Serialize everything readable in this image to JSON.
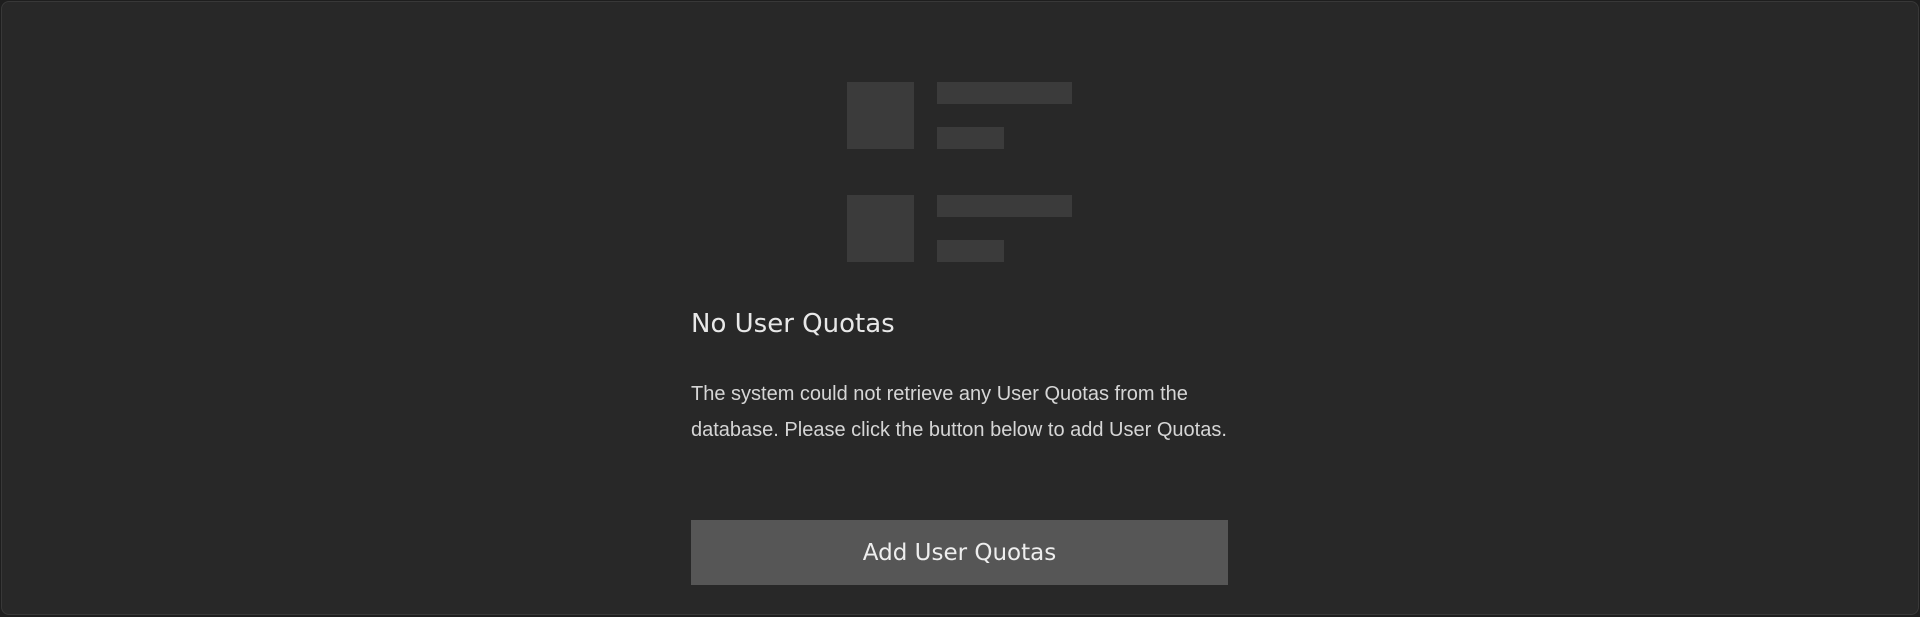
{
  "empty_state": {
    "illustration_icon": "list-placeholder-icon",
    "title": "No User Quotas",
    "description": "The system could not retrieve any User Quotas from the database. Please click the button below to add User Quotas.",
    "action_label": "Add User Quotas"
  },
  "colors": {
    "panel_background": "#282828",
    "button_background": "#565656",
    "placeholder_block": "#3b3b3b",
    "text": "#e8e8e8"
  }
}
